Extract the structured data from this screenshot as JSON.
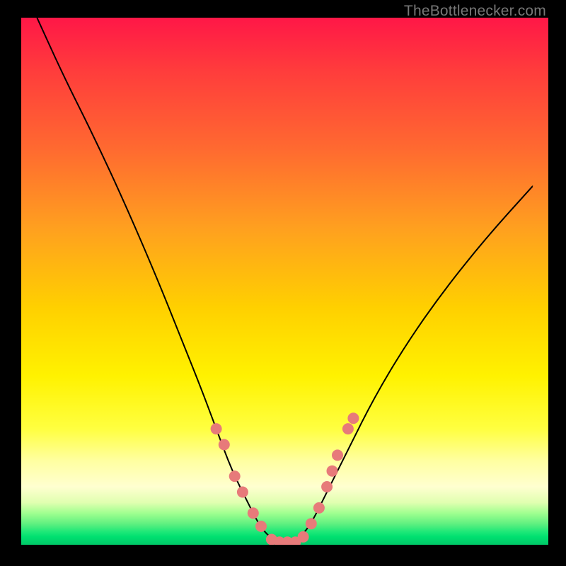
{
  "watermark": "TheBottlenecker.com",
  "chart_data": {
    "type": "line",
    "title": "",
    "xlabel": "",
    "ylabel": "",
    "xlim": [
      0,
      100
    ],
    "ylim": [
      0,
      100
    ],
    "background_gradient": {
      "top_color": "#ff1747",
      "mid_color": "#fff200",
      "bottom_color": "#00c868",
      "semantic": "red-to-green vertical gradient indicating bottleneck severity (red high, green low)"
    },
    "series": [
      {
        "name": "bottleneck-curve",
        "x": [
          3,
          8,
          14,
          20,
          26,
          30,
          34,
          37,
          40,
          43,
          45,
          47,
          49,
          51,
          53,
          55,
          58,
          62,
          67,
          73,
          80,
          88,
          97
        ],
        "y": [
          100,
          89,
          77,
          64,
          50,
          40,
          30,
          22,
          14,
          8,
          4,
          1.5,
          0.5,
          0.5,
          1.5,
          4,
          10,
          18,
          28,
          38,
          48,
          58,
          68
        ],
        "stroke": "#000000",
        "stroke_width": 2
      }
    ],
    "markers": {
      "name": "highlight-dots",
      "color": "#e77a7a",
      "radius": 8,
      "points": [
        {
          "x": 37,
          "y": 22
        },
        {
          "x": 38.5,
          "y": 19
        },
        {
          "x": 40.5,
          "y": 13
        },
        {
          "x": 42,
          "y": 10
        },
        {
          "x": 44,
          "y": 6
        },
        {
          "x": 45.5,
          "y": 3.5
        },
        {
          "x": 47.5,
          "y": 1
        },
        {
          "x": 49,
          "y": 0.5
        },
        {
          "x": 50.5,
          "y": 0.5
        },
        {
          "x": 52,
          "y": 0.5
        },
        {
          "x": 53.5,
          "y": 1.5
        },
        {
          "x": 55,
          "y": 4
        },
        {
          "x": 56.5,
          "y": 7
        },
        {
          "x": 58,
          "y": 11
        },
        {
          "x": 59,
          "y": 14
        },
        {
          "x": 60,
          "y": 17
        },
        {
          "x": 62,
          "y": 22
        },
        {
          "x": 63,
          "y": 24
        }
      ]
    }
  }
}
